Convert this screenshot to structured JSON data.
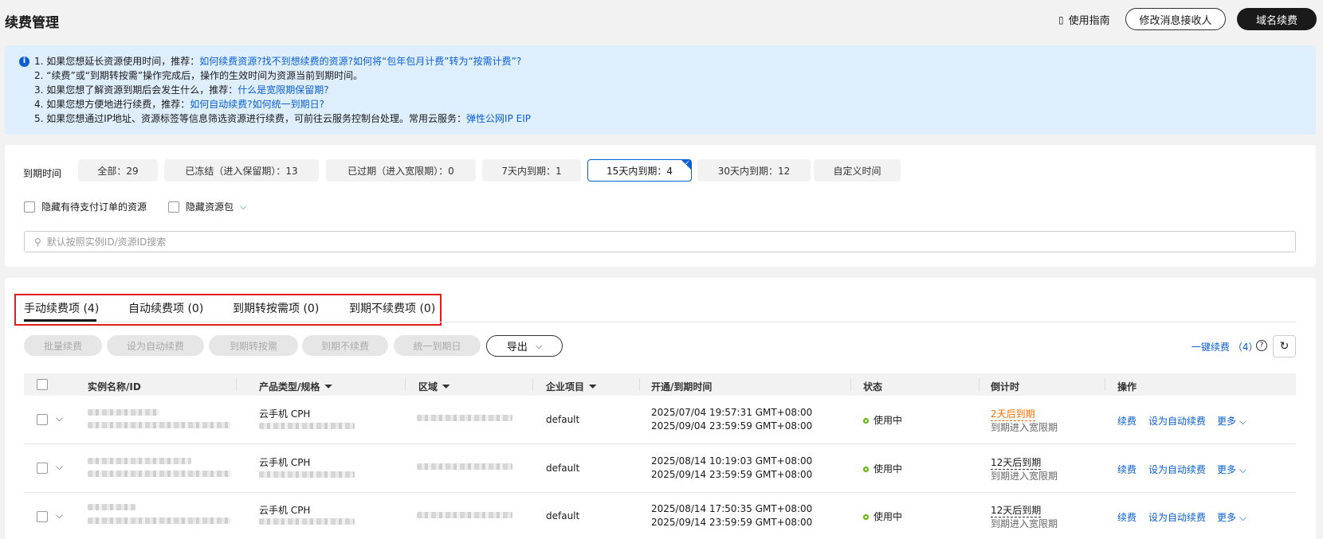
{
  "header": {
    "title": "续费管理",
    "guide": "使用指南",
    "modify_receiver": "修改消息接收人",
    "domain_renew": "域名续费"
  },
  "notice": {
    "line1_prefix": "1. 如果您想延长资源使用时间，推荐：",
    "line1_links": [
      "如何续费资源?",
      "找不到想续费的资源?",
      "如何将“包年包月计费”转为“按需计费”?"
    ],
    "line2": "2. “续费”或“到期转按需”操作完成后，操作的生效时间为资源当前到期时间。",
    "line3_prefix": "3. 如果您想了解资源到期后会发生什么，推荐：",
    "line3_link": "什么是宽限期保留期?",
    "line4_prefix": "4. 如果您想方便地进行续费，推荐：",
    "line4_links": [
      "如何自动续费?",
      "如何统一到期日?"
    ],
    "line5_prefix": "5. 如果您想通过IP地址、资源标签等信息筛选资源进行续费，可前往云服务控制台处理。常用云服务：",
    "line5_link": "弹性公网IP EIP"
  },
  "filters": {
    "label": "到期时间",
    "chips": [
      "全部：29",
      "已冻结（进入保留期）：13",
      "已过期（进入宽限期）：0",
      "7天内到期：1",
      "15天内到期：4",
      "30天内到期：12",
      "自定义时间"
    ],
    "active_index": 4,
    "hide_pending": "隐藏有待支付订单的资源",
    "hide_package": "隐藏资源包",
    "search_placeholder": "默认按照实例ID/资源ID搜索"
  },
  "tabs": [
    "手动续费项 (4)",
    "自动续费项 (0)",
    "到期转按需项 (0)",
    "到期不续费项 (0)"
  ],
  "toolbar": {
    "batch": "批量续费",
    "set_auto": "设为自动续费",
    "to_ondemand": "到期转按需",
    "no_renew": "到期不续费",
    "unify": "统一到期日",
    "export": "导出",
    "onekey": "一键续费 （4）"
  },
  "table": {
    "headers": [
      "实例名称/ID",
      "产品类型/规格",
      "区域",
      "企业项目",
      "开通/到期时间",
      "状态",
      "倒计时",
      "操作"
    ],
    "rows": [
      {
        "product": "云手机 CPH",
        "project": "default",
        "open": "2025/07/04 19:57:31 GMT+08:00",
        "expire": "2025/09/04 23:59:59 GMT+08:00",
        "status": "使用中",
        "countdown": "2天后到期",
        "countdown_warn": true,
        "sub": "到期进入宽限期",
        "ops": [
          "续费",
          "设为自动续费",
          "更多"
        ]
      },
      {
        "product": "云手机 CPH",
        "project": "default",
        "open": "2025/08/14 10:19:03 GMT+08:00",
        "expire": "2025/09/14 23:59:59 GMT+08:00",
        "status": "使用中",
        "countdown": "12天后到期",
        "countdown_warn": false,
        "sub": "到期进入宽限期",
        "ops": [
          "续费",
          "设为自动续费",
          "更多"
        ]
      },
      {
        "product": "云手机 CPH",
        "project": "default",
        "open": "2025/08/14 17:50:35 GMT+08:00",
        "expire": "2025/09/14 23:59:59 GMT+08:00",
        "status": "使用中",
        "countdown": "12天后到期",
        "countdown_warn": false,
        "sub": "到期进入宽限期",
        "ops": [
          "续费",
          "设为自动续费",
          "更多"
        ]
      }
    ]
  }
}
